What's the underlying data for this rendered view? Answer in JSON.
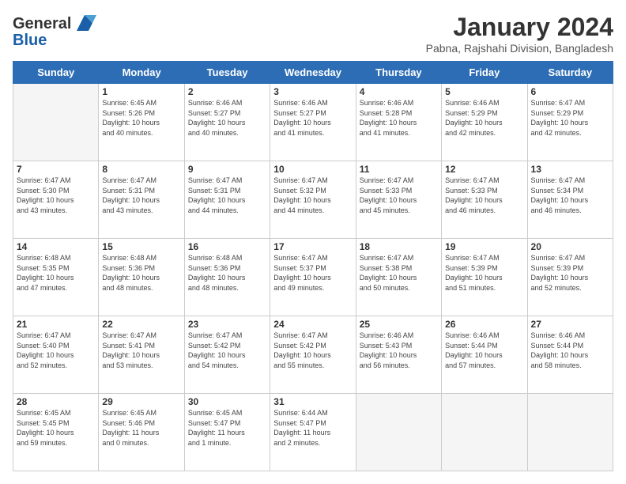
{
  "logo": {
    "line1": "General",
    "line2": "Blue"
  },
  "header": {
    "month": "January 2024",
    "location": "Pabna, Rajshahi Division, Bangladesh"
  },
  "days": [
    "Sunday",
    "Monday",
    "Tuesday",
    "Wednesday",
    "Thursday",
    "Friday",
    "Saturday"
  ],
  "weeks": [
    [
      {
        "day": "",
        "info": ""
      },
      {
        "day": "1",
        "info": "Sunrise: 6:45 AM\nSunset: 5:26 PM\nDaylight: 10 hours\nand 40 minutes."
      },
      {
        "day": "2",
        "info": "Sunrise: 6:46 AM\nSunset: 5:27 PM\nDaylight: 10 hours\nand 40 minutes."
      },
      {
        "day": "3",
        "info": "Sunrise: 6:46 AM\nSunset: 5:27 PM\nDaylight: 10 hours\nand 41 minutes."
      },
      {
        "day": "4",
        "info": "Sunrise: 6:46 AM\nSunset: 5:28 PM\nDaylight: 10 hours\nand 41 minutes."
      },
      {
        "day": "5",
        "info": "Sunrise: 6:46 AM\nSunset: 5:29 PM\nDaylight: 10 hours\nand 42 minutes."
      },
      {
        "day": "6",
        "info": "Sunrise: 6:47 AM\nSunset: 5:29 PM\nDaylight: 10 hours\nand 42 minutes."
      }
    ],
    [
      {
        "day": "7",
        "info": "Sunrise: 6:47 AM\nSunset: 5:30 PM\nDaylight: 10 hours\nand 43 minutes."
      },
      {
        "day": "8",
        "info": "Sunrise: 6:47 AM\nSunset: 5:31 PM\nDaylight: 10 hours\nand 43 minutes."
      },
      {
        "day": "9",
        "info": "Sunrise: 6:47 AM\nSunset: 5:31 PM\nDaylight: 10 hours\nand 44 minutes."
      },
      {
        "day": "10",
        "info": "Sunrise: 6:47 AM\nSunset: 5:32 PM\nDaylight: 10 hours\nand 44 minutes."
      },
      {
        "day": "11",
        "info": "Sunrise: 6:47 AM\nSunset: 5:33 PM\nDaylight: 10 hours\nand 45 minutes."
      },
      {
        "day": "12",
        "info": "Sunrise: 6:47 AM\nSunset: 5:33 PM\nDaylight: 10 hours\nand 46 minutes."
      },
      {
        "day": "13",
        "info": "Sunrise: 6:47 AM\nSunset: 5:34 PM\nDaylight: 10 hours\nand 46 minutes."
      }
    ],
    [
      {
        "day": "14",
        "info": "Sunrise: 6:48 AM\nSunset: 5:35 PM\nDaylight: 10 hours\nand 47 minutes."
      },
      {
        "day": "15",
        "info": "Sunrise: 6:48 AM\nSunset: 5:36 PM\nDaylight: 10 hours\nand 48 minutes."
      },
      {
        "day": "16",
        "info": "Sunrise: 6:48 AM\nSunset: 5:36 PM\nDaylight: 10 hours\nand 48 minutes."
      },
      {
        "day": "17",
        "info": "Sunrise: 6:47 AM\nSunset: 5:37 PM\nDaylight: 10 hours\nand 49 minutes."
      },
      {
        "day": "18",
        "info": "Sunrise: 6:47 AM\nSunset: 5:38 PM\nDaylight: 10 hours\nand 50 minutes."
      },
      {
        "day": "19",
        "info": "Sunrise: 6:47 AM\nSunset: 5:39 PM\nDaylight: 10 hours\nand 51 minutes."
      },
      {
        "day": "20",
        "info": "Sunrise: 6:47 AM\nSunset: 5:39 PM\nDaylight: 10 hours\nand 52 minutes."
      }
    ],
    [
      {
        "day": "21",
        "info": "Sunrise: 6:47 AM\nSunset: 5:40 PM\nDaylight: 10 hours\nand 52 minutes."
      },
      {
        "day": "22",
        "info": "Sunrise: 6:47 AM\nSunset: 5:41 PM\nDaylight: 10 hours\nand 53 minutes."
      },
      {
        "day": "23",
        "info": "Sunrise: 6:47 AM\nSunset: 5:42 PM\nDaylight: 10 hours\nand 54 minutes."
      },
      {
        "day": "24",
        "info": "Sunrise: 6:47 AM\nSunset: 5:42 PM\nDaylight: 10 hours\nand 55 minutes."
      },
      {
        "day": "25",
        "info": "Sunrise: 6:46 AM\nSunset: 5:43 PM\nDaylight: 10 hours\nand 56 minutes."
      },
      {
        "day": "26",
        "info": "Sunrise: 6:46 AM\nSunset: 5:44 PM\nDaylight: 10 hours\nand 57 minutes."
      },
      {
        "day": "27",
        "info": "Sunrise: 6:46 AM\nSunset: 5:44 PM\nDaylight: 10 hours\nand 58 minutes."
      }
    ],
    [
      {
        "day": "28",
        "info": "Sunrise: 6:45 AM\nSunset: 5:45 PM\nDaylight: 10 hours\nand 59 minutes."
      },
      {
        "day": "29",
        "info": "Sunrise: 6:45 AM\nSunset: 5:46 PM\nDaylight: 11 hours\nand 0 minutes."
      },
      {
        "day": "30",
        "info": "Sunrise: 6:45 AM\nSunset: 5:47 PM\nDaylight: 11 hours\nand 1 minute."
      },
      {
        "day": "31",
        "info": "Sunrise: 6:44 AM\nSunset: 5:47 PM\nDaylight: 11 hours\nand 2 minutes."
      },
      {
        "day": "",
        "info": ""
      },
      {
        "day": "",
        "info": ""
      },
      {
        "day": "",
        "info": ""
      }
    ]
  ]
}
